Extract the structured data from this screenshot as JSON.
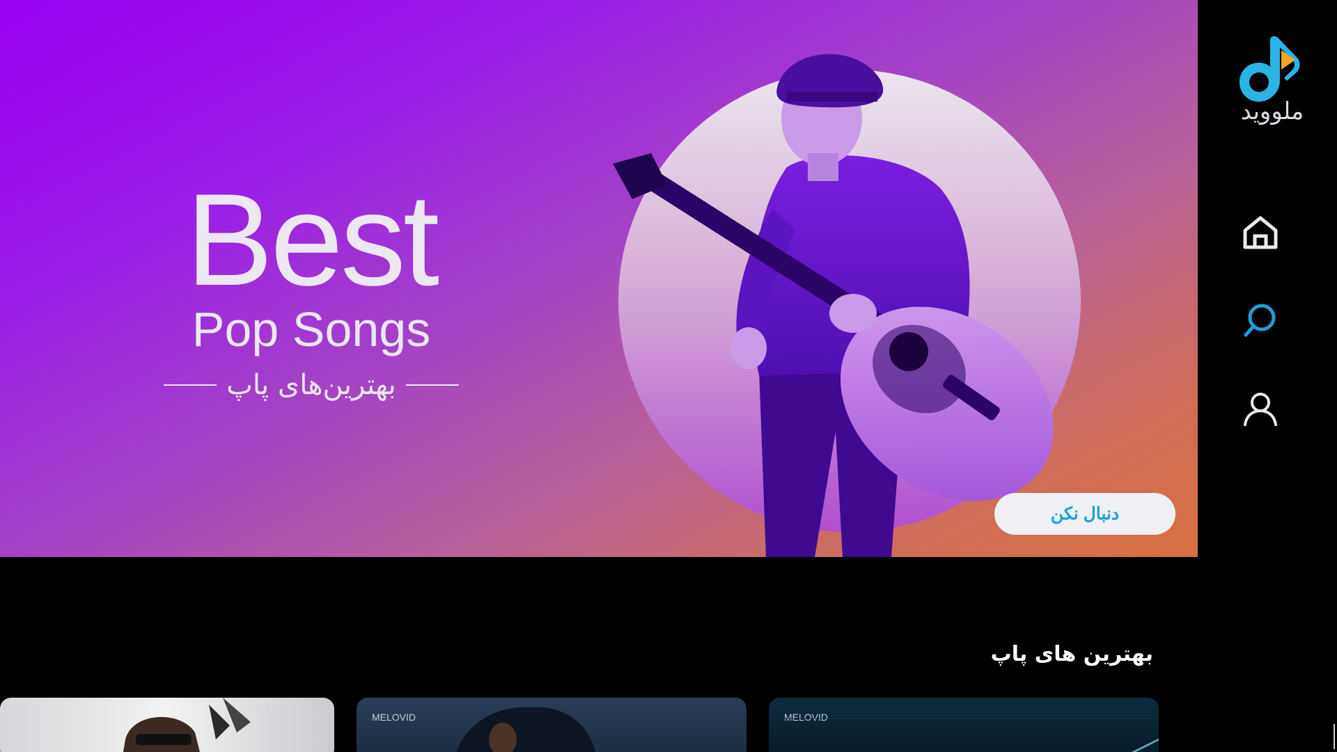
{
  "hero": {
    "title_en": "Best",
    "subtitle_en": "Pop Songs",
    "subtitle_fa": "بهترین‌های پاپ",
    "cta_label": "دنبال نکن"
  },
  "sidebar": {
    "logo_text": "ملووید",
    "nav": [
      {
        "id": "home",
        "icon": "home-icon"
      },
      {
        "id": "search",
        "icon": "search-icon",
        "active": true
      },
      {
        "id": "profile",
        "icon": "user-icon"
      }
    ]
  },
  "section": {
    "title": "بهترین های پاپ",
    "cards": [
      {
        "label": ""
      },
      {
        "label": "MELOVID"
      },
      {
        "label": "MELOVID"
      }
    ]
  },
  "colors": {
    "accent": "#1aa0d8",
    "logo_blue": "#2bb3e6",
    "logo_orange": "#f5a623",
    "background": "#000000"
  }
}
